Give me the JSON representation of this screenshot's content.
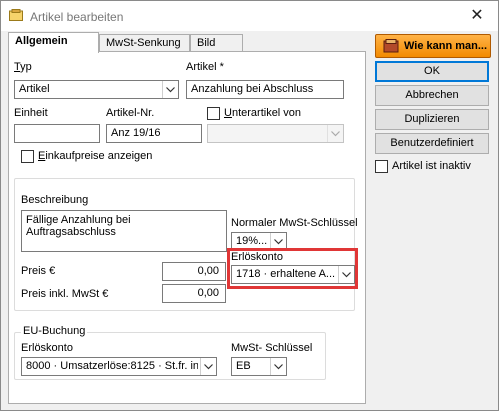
{
  "window": {
    "title": "Artikel bearbeiten",
    "close_glyph": "✕"
  },
  "tabs": [
    {
      "label": "Allgemein",
      "active": true
    },
    {
      "label": "MwSt-Senkung",
      "active": false
    },
    {
      "label": "Bild",
      "active": false
    }
  ],
  "form": {
    "typ_label": "Typ",
    "typ_value": "Artikel",
    "artikel_label": "Artikel *",
    "artikel_value": "Anzahlung bei Abschluss",
    "einheit_label": "Einheit",
    "einheit_value": "",
    "artikelnr_label": "Artikel-Nr.",
    "artikelnr_value": "Anz 19/16",
    "unterartikel_label": "Unterartikel von",
    "unterartikel_checked": false,
    "unterartikel_value": "",
    "einkaufspreise_label": "Einkaufpreise anzeigen",
    "einkaufspreise_checked": false,
    "beschreibung_label": "Beschreibung",
    "beschreibung_value": "Fällige Anzahlung bei Auftragsabschluss",
    "mwst_label": "Normaler MwSt-Schlüssel",
    "mwst_value": "19%...",
    "erloeskonto_label": "Erlöskonto",
    "erloeskonto_value": "1718 · erhaltene A...",
    "preis_label": "Preis €",
    "preis_value": "0,00",
    "preis_mwst_label": "Preis inkl. MwSt €",
    "preis_mwst_value": "0,00"
  },
  "eu_buchung": {
    "group_label": "EU-Buchung",
    "erloeskonto_label": "Erlöskonto",
    "erloeskonto_value": "8000 · Umsatzerlöse:8125 · St.fr. in...",
    "mwst_label": "MwSt- Schlüssel",
    "mwst_value": "EB"
  },
  "buttons": {
    "help": "Wie kann man...",
    "ok": "OK",
    "cancel": "Abbrechen",
    "duplicate": "Duplizieren",
    "custom": "Benutzerdefiniert"
  },
  "inactive_label": "Artikel ist inaktiv",
  "inactive_checked": false,
  "icons": [
    "window-app-icon",
    "close-icon",
    "help-book-icon",
    "dropdown-arrow-icon"
  ],
  "colors": {
    "highlight": "#e03636",
    "help_button": "#f28a00",
    "default_button_border": "#0078d7"
  }
}
